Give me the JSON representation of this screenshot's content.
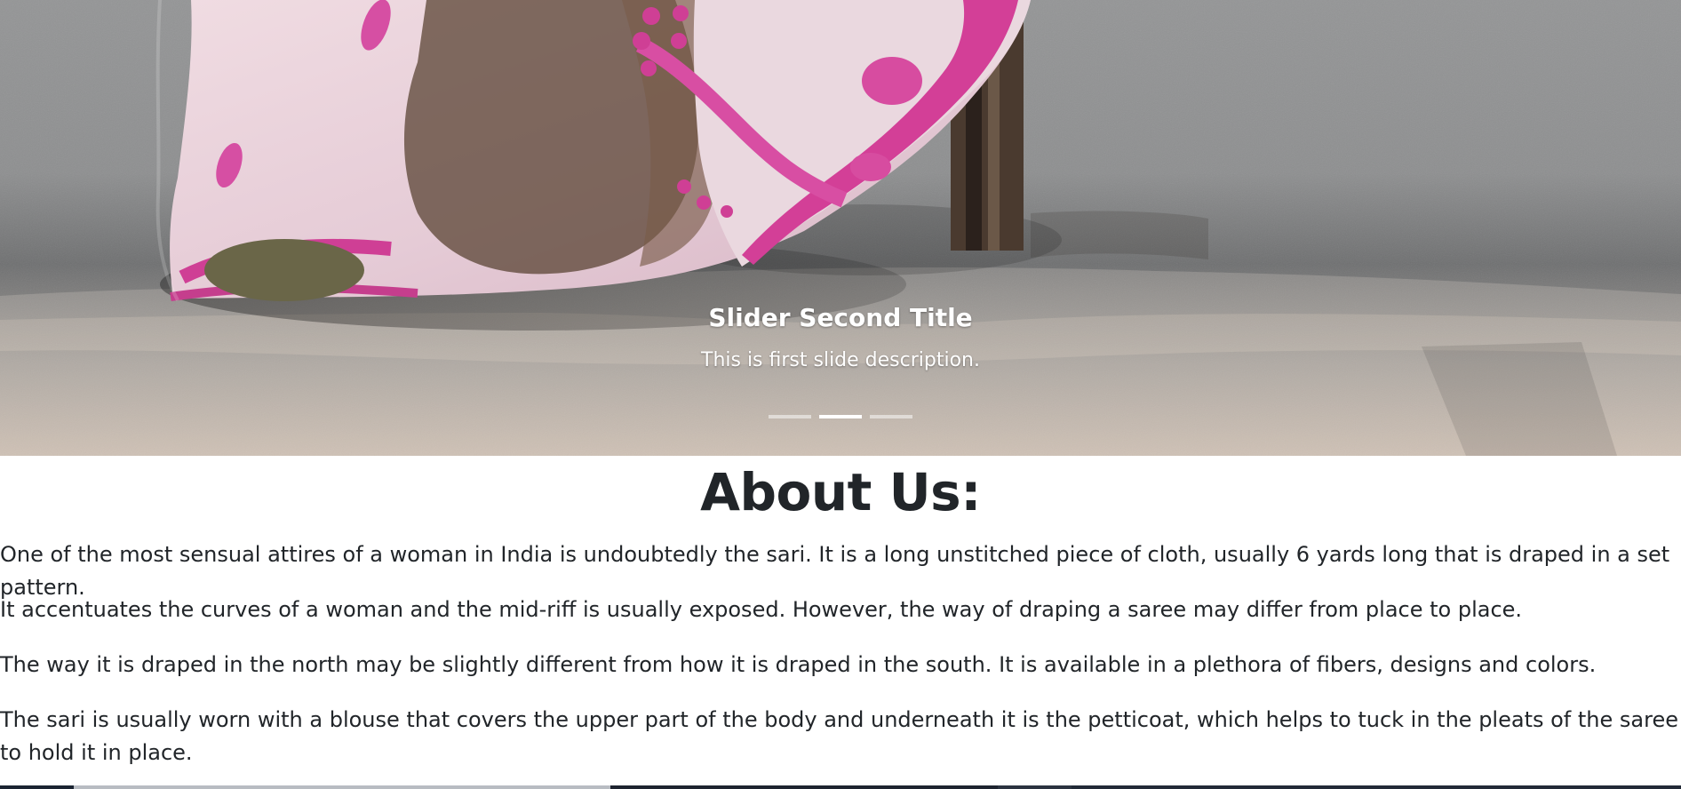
{
  "carousel": {
    "title": "Slider Second Title",
    "description": "This is first slide description.",
    "indicators": [
      "slide-1",
      "slide-2",
      "slide-3"
    ],
    "active_indicator": 2
  },
  "about": {
    "title": "About Us:",
    "paragraphs": [
      "One of the most sensual attires of a woman in India is undoubtedly the sari. It is a long unstitched piece of cloth, usually 6 yards long that is draped in a set pattern.",
      "It accentuates the curves of a woman and the mid-riff is usually exposed. However, the way of draping a saree may differ from place to place.",
      "The way it is draped in the north may be slightly different from how it is draped in the south. It is available in a plethora of fibers, designs and colors.",
      "The sari is usually worn with a blouse that covers the upper part of the body and underneath it is the petticoat, which helps to tuck in the pleats of the saree to hold it in place."
    ]
  },
  "colors": {
    "text": "#212529",
    "caption_text": "#ffffff",
    "saree_pink": "#d94aa0",
    "saree_base": "#ead2dc",
    "road_gray": "#8d8e8f"
  },
  "icons": {
    "hero_image": "saree-road-photo"
  }
}
